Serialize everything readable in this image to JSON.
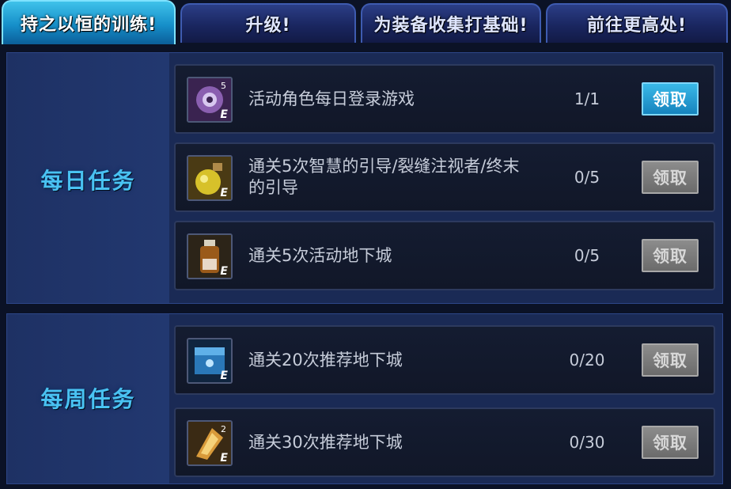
{
  "tabs": [
    {
      "label": "持之以恒的训练!",
      "active": true
    },
    {
      "label": "升级!",
      "active": false
    },
    {
      "label": "为装备收集打基础!",
      "active": false
    },
    {
      "label": "前往更高处!",
      "active": false
    }
  ],
  "daily": {
    "title": "每日任务",
    "tasks": [
      {
        "text": "活动角色每日登录游戏",
        "progress": "1/1",
        "claim_label": "领取",
        "claimable": true,
        "icon": "purple-gear-orb-icon",
        "icon_count": "5"
      },
      {
        "text": "通关5次智慧的引导/裂缝注视者/终末的引导",
        "progress": "0/5",
        "claim_label": "领取",
        "claimable": false,
        "icon": "yellow-potion-pouch-icon",
        "icon_count": ""
      },
      {
        "text": "通关5次活动地下城",
        "progress": "0/5",
        "claim_label": "领取",
        "claimable": false,
        "icon": "brown-bottle-icon",
        "icon_count": ""
      }
    ]
  },
  "weekly": {
    "title": "每周任务",
    "tasks": [
      {
        "text": "通关20次推荐地下城",
        "progress": "0/20",
        "claim_label": "领取",
        "claimable": false,
        "icon": "blue-box-icon",
        "icon_count": ""
      },
      {
        "text": "通关30次推荐地下城",
        "progress": "0/30",
        "claim_label": "领取",
        "claimable": false,
        "icon": "gold-shard-icon",
        "icon_count": "2"
      }
    ]
  },
  "icon_badge": "E",
  "colors": {
    "active_tab": "#168fc9",
    "section_title": "#49c2f2",
    "claim_enabled": "#2aa3d8",
    "claim_disabled": "#7a7a7a"
  }
}
